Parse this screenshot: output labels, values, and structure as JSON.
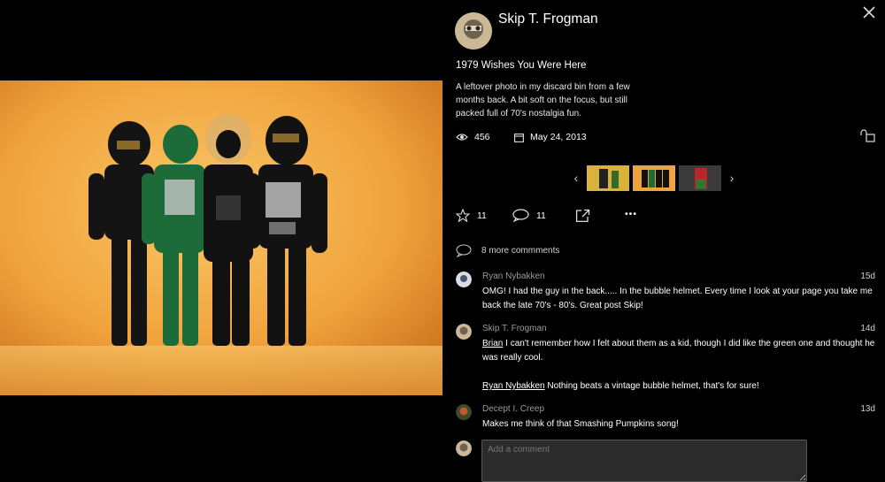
{
  "photo": {
    "alt": "Four action figures on a shelf"
  },
  "owner": {
    "name": "Skip T. Frogman"
  },
  "post": {
    "title": "1979 Wishes You Were Here",
    "description": "A leftover photo in my discard bin from a few months back. A bit soft on the focus, but still packed full of 70's nostalgia fun.",
    "views": "456",
    "date": "May 24, 2013"
  },
  "strip": {
    "prev": "‹",
    "next": "›"
  },
  "actions": {
    "faves": "11",
    "comments": "11",
    "more": "•••"
  },
  "comments": {
    "more_label": "8 more commments",
    "items": [
      {
        "author": "Ryan Nybakken",
        "time": "15d",
        "text": "OMG! I had the guy in the back..... In the bubble helmet. Every time I look at your page you take me back the late 70's - 80's. Great post Skip!"
      },
      {
        "author": "Skip T. Frogman",
        "time": "14d",
        "mention1": "Brian",
        "text1": " I can't remember how I felt about them as a kid, though I did like the green one and thought he was really cool.",
        "mention2": "Ryan Nybakken",
        "text2": " Nothing beats a vintage bubble helmet, that's for sure!"
      },
      {
        "author": "Decept I. Creep",
        "time": "13d",
        "text": "Makes me think of that Smashing Pumpkins song!"
      }
    ],
    "input_placeholder": "Add a comment"
  },
  "colors": {
    "background": "#000000",
    "selected_thumb_border": "#e8a64b",
    "photo_backdrop": "#f0a23c"
  }
}
